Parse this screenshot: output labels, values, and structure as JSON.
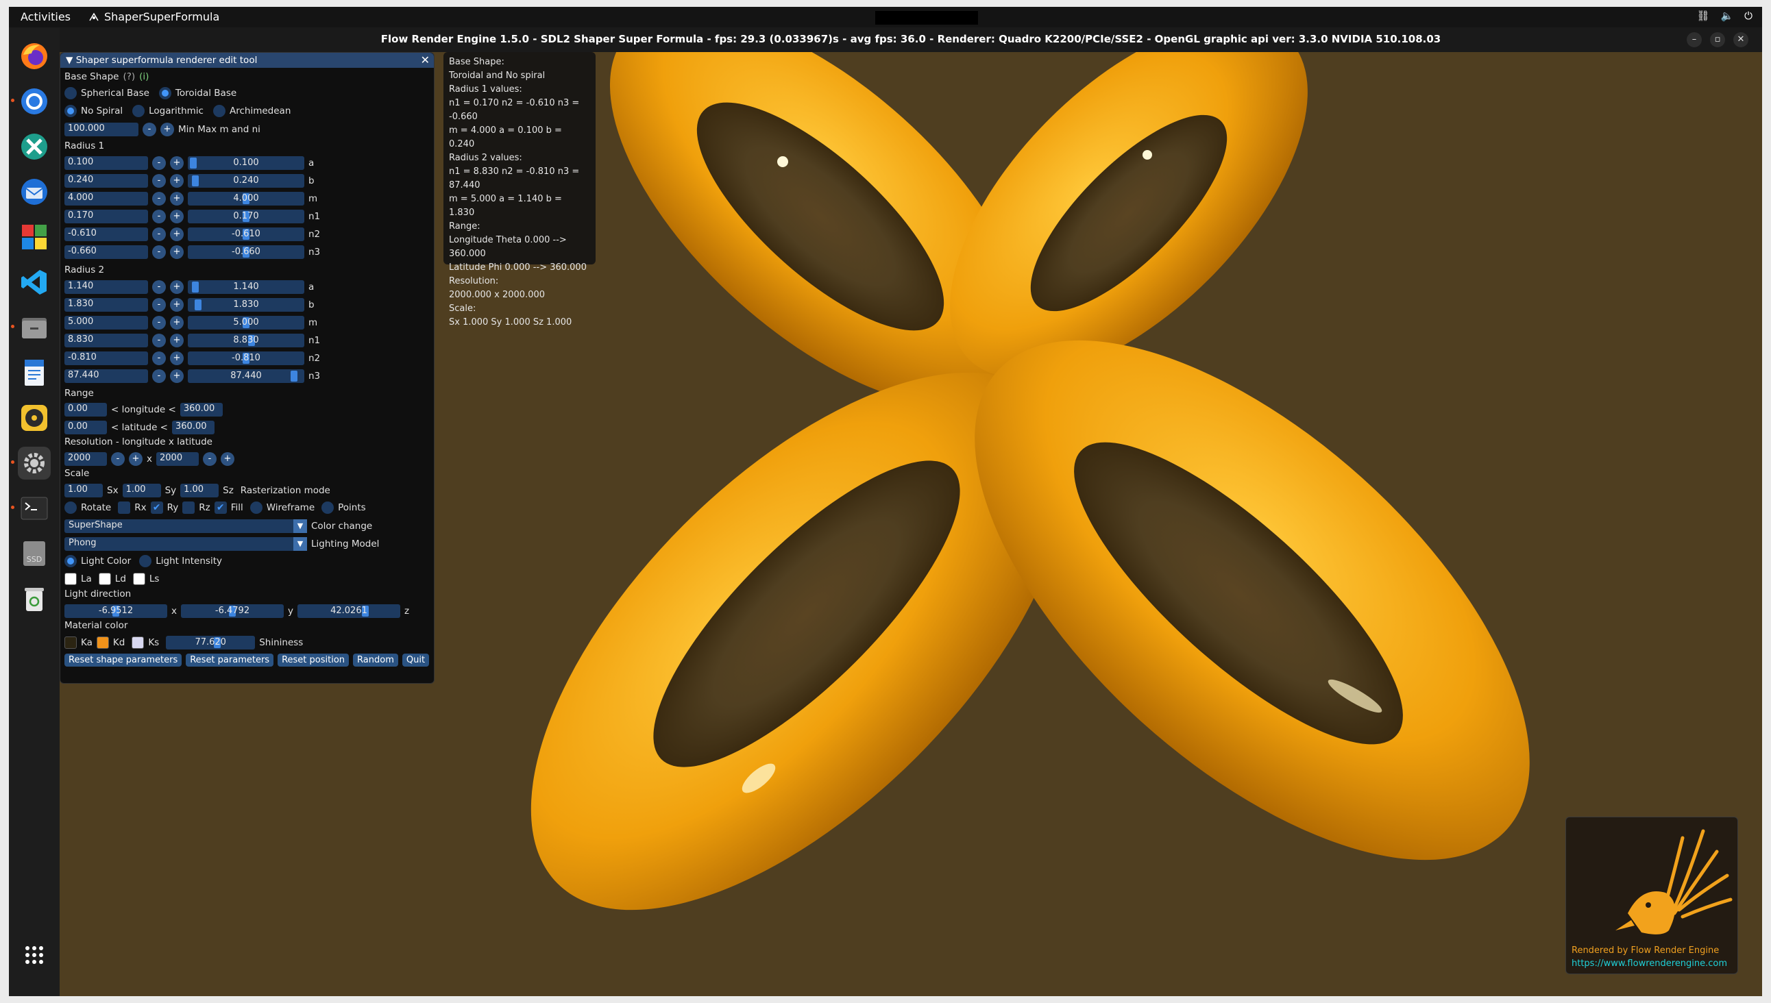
{
  "topbar": {
    "activities": "Activities",
    "app_name": "ShaperSuperFormula"
  },
  "window": {
    "title": "Flow Render Engine 1.5.0 - SDL2 Shaper Super Formula - fps: 29.3 (0.033967)s - avg fps: 36.0 - Renderer: Quadro K2200/PCIe/SSE2 - OpenGL graphic api ver: 3.3.0 NVIDIA 510.108.03"
  },
  "panel": {
    "title": "Shaper superformula renderer edit tool",
    "base_shape_label": "Base Shape",
    "help_q": "(?)",
    "help_i": "(i)",
    "spherical": "Spherical Base",
    "toroidal": "Toroidal Base",
    "no_spiral": "No Spiral",
    "logarithmic": "Logarithmic",
    "archimedean": "Archimedean",
    "minmax_value": "100.000",
    "minmax_label": "Min Max m and ni",
    "radius1_label": "Radius 1",
    "radius2_label": "Radius 2",
    "radius1": [
      {
        "input": "0.100",
        "slider": "0.100",
        "name": "a",
        "level": 0.02
      },
      {
        "input": "0.240",
        "slider": "0.240",
        "name": "b",
        "level": 0.04
      },
      {
        "input": "4.000",
        "slider": "4.000",
        "name": "m",
        "level": 0.5
      },
      {
        "input": "0.170",
        "slider": "0.170",
        "name": "n1",
        "level": 0.5
      },
      {
        "input": "-0.610",
        "slider": "-0.610",
        "name": "n2",
        "level": 0.5
      },
      {
        "input": "-0.660",
        "slider": "-0.660",
        "name": "n3",
        "level": 0.5
      }
    ],
    "radius2": [
      {
        "input": "1.140",
        "slider": "1.140",
        "name": "a",
        "level": 0.04
      },
      {
        "input": "1.830",
        "slider": "1.830",
        "name": "b",
        "level": 0.06
      },
      {
        "input": "5.000",
        "slider": "5.000",
        "name": "m",
        "level": 0.5
      },
      {
        "input": "8.830",
        "slider": "8.830",
        "name": "n1",
        "level": 0.55
      },
      {
        "input": "-0.810",
        "slider": "-0.810",
        "name": "n2",
        "level": 0.5
      },
      {
        "input": "87.440",
        "slider": "87.440",
        "name": "n3",
        "level": 0.94
      }
    ],
    "range_label": "Range",
    "lon_min": "0.00",
    "lon_text": "< longitude <",
    "lon_max": "360.00",
    "lat_min": "0.00",
    "lat_text": "< latitude <",
    "lat_max": "360.00",
    "resolution_label": "Resolution - longitude x latitude",
    "res_lon": "2000",
    "res_x": "x",
    "res_lat": "2000",
    "scale_label": "Scale",
    "sx_val": "1.00",
    "sx": "Sx",
    "sy_val": "1.00",
    "sy": "Sy",
    "sz_val": "1.00",
    "sz": "Sz",
    "raster_label": "Rasterization mode",
    "rotate": "Rotate",
    "rx": "Rx",
    "ry": "Ry",
    "rz": "Rz",
    "fill": "Fill",
    "wireframe": "Wireframe",
    "points": "Points",
    "color_combo": "SuperShape",
    "color_label": "Color change",
    "lighting_combo": "Phong",
    "lighting_label": "Lighting Model",
    "light_color": "Light Color",
    "light_intensity": "Light Intensity",
    "la": "La",
    "ld": "Ld",
    "ls": "Ls",
    "light_dir_label": "Light direction",
    "ldx": "-6.9512",
    "ldx_n": "x",
    "ldy": "-6.4792",
    "ldy_n": "y",
    "ldz": "42.0261",
    "ldz_n": "z",
    "material_label": "Material color",
    "ka": "Ka",
    "kd": "Kd",
    "ks": "Ks",
    "shininess_val": "77.620",
    "shininess": "Shininess",
    "btn_reset_shape": "Reset shape parameters",
    "btn_reset_params": "Reset parameters",
    "btn_reset_pos": "Reset position",
    "btn_random": "Random",
    "btn_quit": "Quit",
    "colors": {
      "kd": "#f0921a",
      "ka": "#2b2412",
      "ks": "#d8d8f0",
      "accent": "#4296fa"
    }
  },
  "info": {
    "lines": [
      "Base Shape:",
      "Toroidal and No spiral",
      "Radius 1 values:",
      "n1 = 0.170 n2 = -0.610 n3 = -0.660",
      "m = 4.000 a = 0.100 b = 0.240",
      "Radius 2 values:",
      "n1 = 8.830 n2 = -0.810 n3 = 87.440",
      "m = 5.000 a = 1.140 b = 1.830",
      "Range:",
      "Longitude Theta 0.000 --> 360.000",
      "Latitude Phi 0.000 --> 360.000",
      "Resolution:",
      "2000.000 x 2000.000",
      "Scale:",
      "Sx 1.000 Sy 1.000 Sz 1.000"
    ]
  },
  "logo": {
    "line1": "Rendered by Flow Render Engine",
    "line2": "https://www.flowrenderengine.com"
  },
  "dock": [
    "firefox-icon",
    "chrome-icon",
    "crossover-icon",
    "thunderbird-icon",
    "office-icon",
    "vscode-icon",
    "files-icon",
    "writer-icon",
    "rhythmbox-icon",
    "settings-icon",
    "terminal-icon",
    "ssd-icon",
    "trash-icon",
    "app-grid-icon"
  ]
}
